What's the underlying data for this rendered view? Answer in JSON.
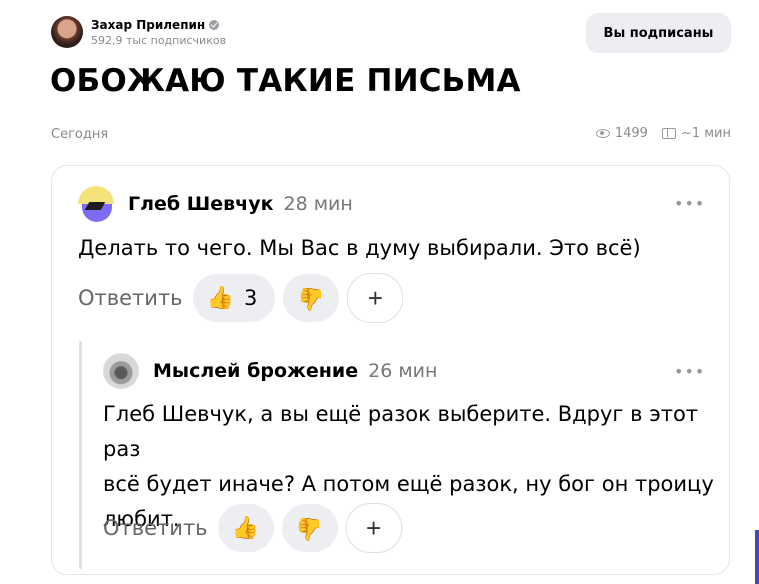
{
  "header": {
    "author_name": "Захар Прилепин",
    "subscribers": "592,9 тыс подписчиков",
    "subscribe_button": "Вы подписаны"
  },
  "article": {
    "title": "ОБОЖАЮ ТАКИЕ ПИСЬМА",
    "date": "Сегодня",
    "views": "1499",
    "read_time": "~1 мин"
  },
  "comments": [
    {
      "author": "Глеб Шевчук",
      "time": "28 мин",
      "text": "Делать то чего. Мы Вас в думу выбирали. Это всё)",
      "reply_label": "Ответить",
      "likes": "3"
    },
    {
      "author": "Мыслей брожение",
      "time": "26 мин",
      "text_lines": [
        "Глеб Шевчук, а вы ещё разок выберите. Вдруг в этот раз",
        "всё будет иначе? А потом ещё разок, ну бог он троицу",
        "любит."
      ],
      "reply_label": "Ответить"
    }
  ],
  "icons": {
    "thumb_up": "👍",
    "thumb_down": "👍",
    "add": "+",
    "more": "•••"
  }
}
